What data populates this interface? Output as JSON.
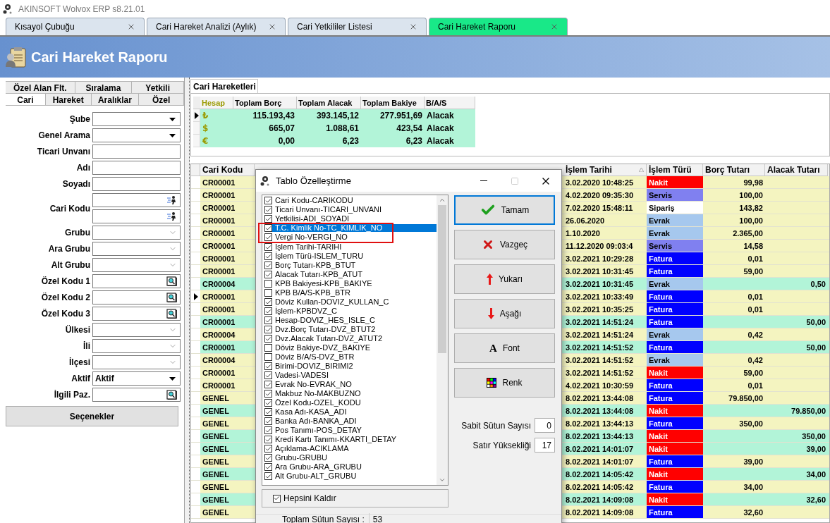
{
  "window": {
    "title": "AKINSOFT Wolvox ERP s8.21.01"
  },
  "tabs": [
    {
      "label": "Kısayol Çubuğu",
      "selected": false
    },
    {
      "label": "Cari Hareket Analizi (Aylık)",
      "selected": false
    },
    {
      "label": "Cari Yetkililer Listesi",
      "selected": false
    },
    {
      "label": "Cari Hareket Raporu",
      "selected": true
    }
  ],
  "page_title": "Cari Hareket Raporu",
  "filter_panel": {
    "tabs_row_1": [
      {
        "label": "Özel Alan Flt.",
        "selected": false
      },
      {
        "label": "Sıralama",
        "selected": false
      },
      {
        "label": "Yetkili",
        "selected": false
      }
    ],
    "tabs_row_2": [
      {
        "label": "Cari",
        "selected": true
      },
      {
        "label": "Hareket",
        "selected": false
      },
      {
        "label": "Aralıklar",
        "selected": false
      },
      {
        "label": "Özel",
        "selected": false
      }
    ],
    "fields": [
      {
        "label": "Şube",
        "kind": "dropdown"
      },
      {
        "label": "Genel Arama",
        "kind": "dropdown"
      },
      {
        "label": "Ticari Unvanı",
        "kind": "text"
      },
      {
        "label": "Adı",
        "kind": "text"
      },
      {
        "label": "Soyadı",
        "kind": "text"
      },
      {
        "label": "Cari Kodu",
        "kind": "range"
      },
      {
        "label": "Grubu",
        "kind": "combo"
      },
      {
        "label": "Ara Grubu",
        "kind": "combo"
      },
      {
        "label": "Alt Grubu",
        "kind": "combo"
      },
      {
        "label": "Özel Kodu 1",
        "kind": "lookup"
      },
      {
        "label": "Özel Kodu 2",
        "kind": "lookup"
      },
      {
        "label": "Özel Kodu 3",
        "kind": "lookup"
      },
      {
        "label": "Ülkesi",
        "kind": "combo"
      },
      {
        "label": "İli",
        "kind": "combo"
      },
      {
        "label": "İlçesi",
        "kind": "combo"
      },
      {
        "label": "Aktif",
        "kind": "dropdown",
        "value": "Aktif"
      },
      {
        "label": "İlgili Paz.",
        "kind": "lookup"
      }
    ],
    "options_button": "Seçenekler"
  },
  "results": {
    "tab": "Cari Hareketleri",
    "summary": {
      "columns": [
        "Hesap",
        "Toplam Borç",
        "Toplam Alacak",
        "Toplam Bakiye",
        "B/A/S"
      ],
      "rows": [
        {
          "hesap": "₺",
          "toplam_borc": "115.193,43",
          "toplam_alacak": "393.145,12",
          "toplam_bakiye": "277.951,69",
          "bas": "Alacak",
          "selected": true
        },
        {
          "hesap": "$",
          "toplam_borc": "665,07",
          "toplam_alacak": "1.088,61",
          "toplam_bakiye": "423,54",
          "bas": "Alacak",
          "selected": false
        },
        {
          "hesap": "€",
          "toplam_borc": "0,00",
          "toplam_alacak": "6,23",
          "toplam_bakiye": "6,23",
          "bas": "Alacak",
          "selected": false
        }
      ]
    },
    "grid": {
      "columns": [
        {
          "label": "Cari Kodu",
          "sorted": false
        },
        {
          "label": "İşlem Tarihi",
          "sorted": true
        },
        {
          "label": "İşlem Türü",
          "sorted": false
        },
        {
          "label": "Borç Tutarı",
          "sorted": false
        },
        {
          "label": "Alacak Tutarı",
          "sorted": false
        }
      ],
      "rows": [
        {
          "cari_kodu": "CR00001",
          "islem_tarihi": "3.02.2020 10:48:25",
          "islem_turu": {
            "text": "Nakit",
            "color": "#ff0000"
          },
          "borc_tutari": "99,98",
          "color": "#f4f4c0",
          "selected": false
        },
        {
          "cari_kodu": "CR00001",
          "islem_tarihi": "4.02.2020 09:35:30",
          "islem_turu": {
            "text": "Servis",
            "color": "#8080f0"
          },
          "borc_tutari": "100,00",
          "color": "#f4f4c0",
          "selected": false
        },
        {
          "cari_kodu": "CR00001",
          "islem_tarihi": "7.02.2020 15:48:11",
          "islem_turu": {
            "text": "Sipariş",
            "color": "#ffffff"
          },
          "borc_tutari": "143,82",
          "color": "#f4f4c0",
          "selected": false
        },
        {
          "cari_kodu": "CR00001",
          "islem_tarihi": "26.06.2020",
          "islem_turu": {
            "text": "Evrak",
            "color": "#a6c8ee"
          },
          "borc_tutari": "100,00",
          "color": "#f4f4c0",
          "selected": false
        },
        {
          "cari_kodu": "CR00001",
          "islem_tarihi": "1.10.2020",
          "islem_turu": {
            "text": "Evrak",
            "color": "#a6c8ee"
          },
          "borc_tutari": "2.365,00",
          "color": "#f4f4c0",
          "selected": false
        },
        {
          "cari_kodu": "CR00001",
          "islem_tarihi": "11.12.2020 09:03:4",
          "islem_turu": {
            "text": "Servis",
            "color": "#8080f0"
          },
          "borc_tutari": "14,58",
          "color": "#f4f4c0",
          "selected": false
        },
        {
          "cari_kodu": "CR00001",
          "islem_tarihi": "3.02.2021 10:29:28",
          "islem_turu": {
            "text": "Fatura",
            "color": "#0000ff"
          },
          "borc_tutari": "0,01",
          "color": "#f4f4c0",
          "selected": false
        },
        {
          "cari_kodu": "CR00001",
          "islem_tarihi": "3.02.2021 10:31:45",
          "islem_turu": {
            "text": "Fatura",
            "color": "#0000ff"
          },
          "borc_tutari": "59,00",
          "color": "#f4f4c0",
          "selected": false
        },
        {
          "cari_kodu": "CR00004",
          "islem_tarihi": "3.02.2021 10:31:45",
          "islem_turu": {
            "text": "Evrak",
            "color": "#a6c8ee"
          },
          "alacak_tutari": "0,50",
          "color": "#b2f4d8",
          "selected": false
        },
        {
          "cari_kodu": "CR00001",
          "islem_tarihi": "3.02.2021 10:33:49",
          "islem_turu": {
            "text": "Fatura",
            "color": "#0000ff"
          },
          "borc_tutari": "0,01",
          "color": "#f4f4c0",
          "selected": true
        },
        {
          "cari_kodu": "CR00001",
          "islem_tarihi": "3.02.2021 10:35:25",
          "islem_turu": {
            "text": "Fatura",
            "color": "#0000ff"
          },
          "borc_tutari": "0,01",
          "color": "#f4f4c0",
          "selected": false
        },
        {
          "cari_kodu": "CR00001",
          "islem_tarihi": "3.02.2021 14:51:24",
          "islem_turu": {
            "text": "Fatura",
            "color": "#0000ff"
          },
          "alacak_tutari": "50,00",
          "color": "#b2f4d8",
          "selected": false
        },
        {
          "cari_kodu": "CR00004",
          "islem_tarihi": "3.02.2021 14:51:24",
          "islem_turu": {
            "text": "Evrak",
            "color": "#a6c8ee"
          },
          "borc_tutari": "0,42",
          "color": "#f4f4c0",
          "selected": false
        },
        {
          "cari_kodu": "CR00001",
          "islem_tarihi": "3.02.2021 14:51:52",
          "islem_turu": {
            "text": "Fatura",
            "color": "#0000ff"
          },
          "alacak_tutari": "50,00",
          "color": "#b2f4d8",
          "selected": false
        },
        {
          "cari_kodu": "CR00004",
          "islem_tarihi": "3.02.2021 14:51:52",
          "islem_turu": {
            "text": "Evrak",
            "color": "#a6c8ee"
          },
          "borc_tutari": "0,42",
          "color": "#f4f4c0",
          "selected": false
        },
        {
          "cari_kodu": "CR00001",
          "islem_tarihi": "3.02.2021 14:51:52",
          "islem_turu": {
            "text": "Nakit",
            "color": "#ff0000"
          },
          "borc_tutari": "59,00",
          "color": "#f4f4c0",
          "selected": false
        },
        {
          "cari_kodu": "CR00001",
          "islem_tarihi": "4.02.2021 10:30:59",
          "islem_turu": {
            "text": "Fatura",
            "color": "#0000ff"
          },
          "borc_tutari": "0,01",
          "color": "#f4f4c0",
          "selected": false
        },
        {
          "cari_kodu": "GENEL",
          "islem_tarihi": "8.02.2021 13:44:08",
          "islem_turu": {
            "text": "Fatura",
            "color": "#0000ff"
          },
          "borc_tutari": "79.850,00",
          "color": "#f4f4c0",
          "selected": false
        },
        {
          "cari_kodu": "GENEL",
          "islem_tarihi": "8.02.2021 13:44:08",
          "islem_turu": {
            "text": "Nakit",
            "color": "#ff0000"
          },
          "alacak_tutari": "79.850,00",
          "color": "#b2f4d8",
          "selected": false
        },
        {
          "cari_kodu": "GENEL",
          "islem_tarihi": "8.02.2021 13:44:13",
          "islem_turu": {
            "text": "Fatura",
            "color": "#0000ff"
          },
          "borc_tutari": "350,00",
          "color": "#f4f4c0",
          "selected": false
        },
        {
          "cari_kodu": "GENEL",
          "islem_tarihi": "8.02.2021 13:44:13",
          "islem_turu": {
            "text": "Nakit",
            "color": "#ff0000"
          },
          "alacak_tutari": "350,00",
          "color": "#b2f4d8",
          "selected": false
        },
        {
          "cari_kodu": "GENEL",
          "islem_tarihi": "8.02.2021 14:01:07",
          "islem_turu": {
            "text": "Nakit",
            "color": "#ff0000"
          },
          "alacak_tutari": "39,00",
          "color": "#b2f4d8",
          "selected": false
        },
        {
          "cari_kodu": "GENEL",
          "islem_tarihi": "8.02.2021 14:01:07",
          "islem_turu": {
            "text": "Fatura",
            "color": "#0000ff"
          },
          "borc_tutari": "39,00",
          "color": "#f4f4c0",
          "selected": false
        },
        {
          "cari_kodu": "GENEL",
          "islem_tarihi": "8.02.2021 14:05:42",
          "islem_turu": {
            "text": "Nakit",
            "color": "#ff0000"
          },
          "alacak_tutari": "34,00",
          "color": "#b2f4d8",
          "selected": false
        },
        {
          "cari_kodu": "GENEL",
          "islem_tarihi": "8.02.2021 14:05:42",
          "islem_turu": {
            "text": "Fatura",
            "color": "#0000ff"
          },
          "borc_tutari": "34,00",
          "color": "#f4f4c0",
          "selected": false
        },
        {
          "cari_kodu": "GENEL",
          "islem_tarihi": "8.02.2021 14:09:08",
          "islem_turu": {
            "text": "Nakit",
            "color": "#ff0000"
          },
          "alacak_tutari": "32,60",
          "color": "#b2f4d8",
          "selected": false
        },
        {
          "cari_kodu": "GENEL",
          "islem_tarihi": "8.02.2021 14:09:08",
          "islem_turu": {
            "text": "Fatura",
            "color": "#0000ff"
          },
          "borc_tutari": "32,60",
          "color": "#f4f4c0",
          "selected": false
        }
      ]
    }
  },
  "dialog": {
    "title": "Tablo Özelleştirme",
    "columns": [
      {
        "label": "Cari Kodu-CARIKODU",
        "checked": true,
        "selected": false
      },
      {
        "label": "Ticari Unvanı-TICARI_UNVANI",
        "checked": true,
        "selected": false
      },
      {
        "label": "Yetkilisi-ADI_SOYADI",
        "checked": true,
        "selected": false
      },
      {
        "label": "T.C. Kimlik No-TC_KIMLIK_NO",
        "checked": true,
        "selected": true
      },
      {
        "label": "Vergi No-VERGI_NO",
        "checked": true,
        "selected": false
      },
      {
        "label": "İşlem Tarihi-TARIHI",
        "checked": true,
        "selected": false
      },
      {
        "label": "İşlem Türü-ISLEM_TURU",
        "checked": true,
        "selected": false
      },
      {
        "label": "Borç Tutarı-KPB_BTUT",
        "checked": true,
        "selected": false
      },
      {
        "label": "Alacak Tutarı-KPB_ATUT",
        "checked": true,
        "selected": false
      },
      {
        "label": "KPB Bakiyesi-KPB_BAKIYE",
        "checked": false,
        "selected": false
      },
      {
        "label": "KPB B/A/S-KPB_BTR",
        "checked": false,
        "selected": false
      },
      {
        "label": "Döviz Kullan-DOVIZ_KULLAN_C",
        "checked": true,
        "selected": false
      },
      {
        "label": "İşlem-KPBDVZ_C",
        "checked": true,
        "selected": false
      },
      {
        "label": "Hesap-DOVIZ_HES_ISLE_C",
        "checked": true,
        "selected": false
      },
      {
        "label": "Dvz.Borç Tutarı-DVZ_BTUT2",
        "checked": true,
        "selected": false
      },
      {
        "label": "Dvz.Alacak Tutarı-DVZ_ATUT2",
        "checked": true,
        "selected": false
      },
      {
        "label": "Döviz Bakiye-DVZ_BAKIYE",
        "checked": false,
        "selected": false
      },
      {
        "label": "Döviz B/A/S-DVZ_BTR",
        "checked": false,
        "selected": false
      },
      {
        "label": "Birimi-DOVIZ_BIRIMI2",
        "checked": true,
        "selected": false
      },
      {
        "label": "Vadesi-VADESI",
        "checked": true,
        "selected": false
      },
      {
        "label": "Evrak No-EVRAK_NO",
        "checked": true,
        "selected": false
      },
      {
        "label": "Makbuz No-MAKBUZNO",
        "checked": true,
        "selected": false
      },
      {
        "label": "Özel Kodu-OZEL_KODU",
        "checked": true,
        "selected": false
      },
      {
        "label": "Kasa Adı-KASA_ADI",
        "checked": true,
        "selected": false
      },
      {
        "label": "Banka Adı-BANKA_ADI",
        "checked": true,
        "selected": false
      },
      {
        "label": "Pos Tanımı-POS_DETAY",
        "checked": true,
        "selected": false
      },
      {
        "label": "Kredi Kartı Tanımı-KKARTI_DETAY",
        "checked": true,
        "selected": false
      },
      {
        "label": "Açıklama-ACIKLAMA",
        "checked": true,
        "selected": false
      },
      {
        "label": "Grubu-GRUBU",
        "checked": true,
        "selected": false
      },
      {
        "label": "Ara Grubu-ARA_GRUBU",
        "checked": true,
        "selected": false
      },
      {
        "label": "Alt Grubu-ALT_GRUBU",
        "checked": true,
        "selected": false
      }
    ],
    "buttons": [
      {
        "label": "Tamam",
        "kind": "ok",
        "focused": true
      },
      {
        "label": "Vazgeç",
        "kind": "cancel",
        "focused": false
      },
      {
        "label": "Yukarı",
        "kind": "up",
        "focused": false
      },
      {
        "label": "Aşağı",
        "kind": "down",
        "focused": false
      },
      {
        "label": "Font",
        "kind": "font",
        "glyph": "A",
        "focused": false
      },
      {
        "label": "Renk",
        "kind": "color",
        "focused": false
      }
    ],
    "fixed_columns": {
      "label": "Sabit Sütun Sayısı",
      "value": "0"
    },
    "row_height": {
      "label": "Satır Yüksekliği",
      "value": "17"
    },
    "select_all": {
      "label": "Hepsini Kaldır",
      "checked": true
    },
    "total": {
      "label": "Toplam Sütun Sayısı :",
      "value": "53"
    }
  }
}
